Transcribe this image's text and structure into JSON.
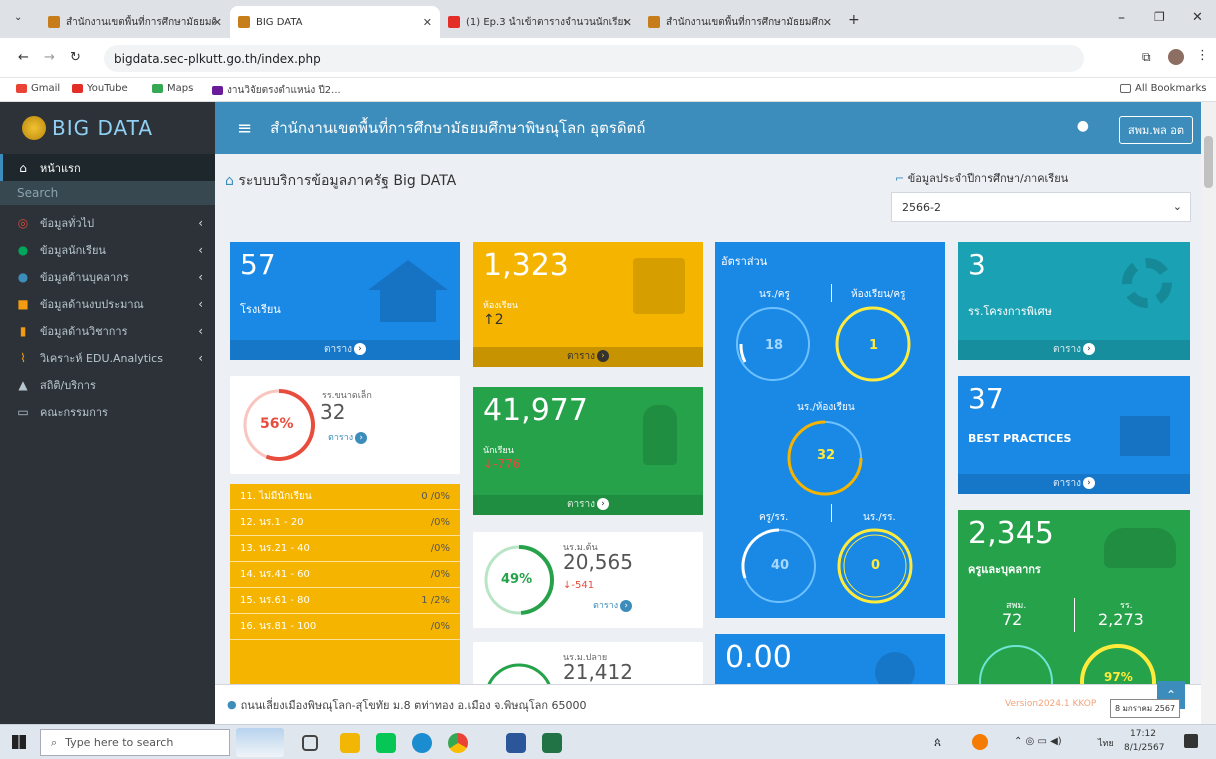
{
  "browser": {
    "tabs": [
      {
        "title": "สำนักงานเขตพื้นที่การศึกษามัธยมศึกษ...",
        "favicon": "#c77d1a"
      },
      {
        "title": "BIG DATA",
        "favicon": "#c77d1a"
      },
      {
        "title": "(1) Ep.3 นำเข้าตารางจำนวนนักเรียน...",
        "favicon": "#e52d27"
      },
      {
        "title": "สำนักงานเขตพื้นที่การศึกษามัธยมศึก...",
        "favicon": "#c77d1a"
      }
    ],
    "url": "bigdata.sec-plkutt.go.th/index.php",
    "bookmarks": [
      "Gmail",
      "YouTube",
      "Maps",
      "งานวิจัยตรงตำแหน่ง ปี2..."
    ],
    "all_bookmarks": "All Bookmarks"
  },
  "app": {
    "logo_text": "BIG DATA",
    "header_title": "สำนักงานเขตพื้นที่การศึกษามัธยมศึกษาพิษณุโลก อุตรดิตถ์",
    "user_button": "สพม.พล อต",
    "search_placeholder": "Search"
  },
  "sidebar": {
    "items": [
      {
        "label": "หน้าแรก",
        "icon": "home-icon",
        "color": "#ffffff"
      },
      {
        "label": "ข้อมูลทั่วไป",
        "icon": "target-icon",
        "color": "#dd4b39"
      },
      {
        "label": "ข้อมูลนักเรียน",
        "icon": "student-icon",
        "color": "#00a65a"
      },
      {
        "label": "ข้อมูลด้านบุคลากร",
        "icon": "user-icon",
        "color": "#3c8dbc"
      },
      {
        "label": "ข้อมูลด้านงบประมาณ",
        "icon": "money-icon",
        "color": "#f39c12"
      },
      {
        "label": "ข้อมูลด้านวิชาการ",
        "icon": "book-icon",
        "color": "#f39c12"
      },
      {
        "label": "วิเคราะห์ EDU.Analytics",
        "icon": "chart-icon",
        "color": "#f39c12"
      },
      {
        "label": "สถิติ/บริการ",
        "icon": "thumbs-up-icon",
        "color": "#ffffff"
      },
      {
        "label": "คณะกรรมการ",
        "icon": "id-card-icon",
        "color": "#ffffff"
      }
    ]
  },
  "content": {
    "heading": "ระบบบริการข้อมูลภาครัฐ Big DATA",
    "year_label": "ข้อมูลประจำปีการศึกษา/ภาคเรียน",
    "year_value": "2566-2",
    "table_link": "ตาราง",
    "schools": {
      "value": "57",
      "label": "โรงเรียน"
    },
    "classrooms": {
      "value": "1,323",
      "label": "ห้องเรียน",
      "change": "↑2"
    },
    "special": {
      "value": "3",
      "label": "รร.โครงการพิเศษ"
    },
    "small": {
      "label": "รร.ขนาดเล็ก",
      "value": "32",
      "pct": "56%",
      "pct_value": 56
    },
    "students": {
      "value": "41,977",
      "label": "นักเรียน",
      "change": "-776"
    },
    "best": {
      "value": "37",
      "label": "BEST PRACTICES"
    },
    "ratio": {
      "title": "อัตราส่วน",
      "labels": [
        "นร./ครู",
        "ห้องเรียน/ครู",
        "นร./ห้องเรียน",
        "ครู/รร.",
        "นร./รร."
      ],
      "values": [
        "18",
        "1",
        "32",
        "40",
        "0"
      ]
    },
    "staff": {
      "value": "2,345",
      "label": "ครูและบุคลากร",
      "sub1_label": "สพม.",
      "sub1_value": "72",
      "sub2_label": "รร.",
      "sub2_value": "2,273",
      "pct2": "97%"
    },
    "lower": {
      "label": "นร.ม.ต้น",
      "value": "20,565",
      "change": "-541",
      "pct": "49%",
      "pct_value": 49
    },
    "upper": {
      "label": "นร.ม.ปลาย",
      "value": "21,412"
    },
    "bluebig": {
      "value": "0.00"
    },
    "size_rows": [
      {
        "label": "11. ไม่มีนักเรียน",
        "val": "0 /0%"
      },
      {
        "label": "12. นร.1 - 20",
        "val": "/0%"
      },
      {
        "label": "13. นร.21 - 40",
        "val": "/0%"
      },
      {
        "label": "14. นร.41 - 60",
        "val": "/0%"
      },
      {
        "label": "15. นร.61 - 80",
        "val": "1 /2%"
      },
      {
        "label": "16. นร.81 - 100",
        "val": "/0%"
      }
    ],
    "footer_address": "ถนนเลี่ยงเมืองพิษณุโลก-สุโขทัย ม.8 ตท่าทอง อ.เมือง จ.พิษณุโลก 65000",
    "version": "Version2024.1 KKOP",
    "tooltip": "8 มกราคม 2567"
  },
  "taskbar": {
    "search": "Type here to search",
    "time": "17:12",
    "date": "8/1/2567",
    "lang": "ไทย"
  },
  "colors": {
    "blue": "#1a88e5",
    "orange": "#f5b400",
    "teal": "#1aa2b4",
    "green": "#25a24a",
    "sidebar": "#2c3237",
    "header": "#3c8dbc"
  }
}
